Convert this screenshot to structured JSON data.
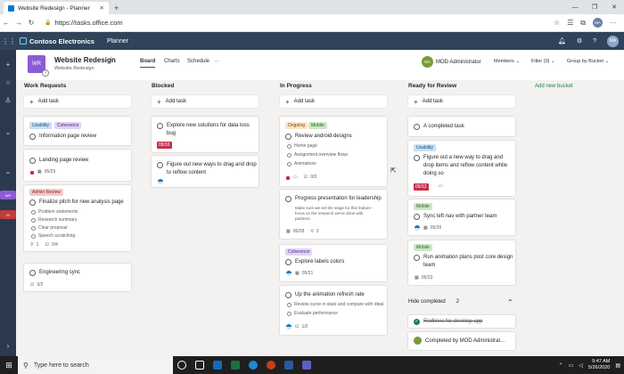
{
  "browser": {
    "tab_title": "Website Redesign - Planner",
    "tab_close": "✕",
    "new_tab": "+",
    "win_min": "—",
    "win_max": "❐",
    "win_close": "✕",
    "url": "https://tasks.office.com",
    "back": "←",
    "forward": "→",
    "refresh": "↻",
    "profile_initials": "MA"
  },
  "app": {
    "brand": "Contoso Electronics",
    "app_name": "Planner",
    "user_initials": "MA"
  },
  "plan": {
    "tile_initials": "WR",
    "info_badge": "i",
    "title": "Website Redesign",
    "star": "☆",
    "subtitle": "Website Redesign",
    "tabs": [
      "Board",
      "Charts",
      "Schedule"
    ],
    "more": "···",
    "owner_initials": "MA",
    "owner_name": "MOD Administrator",
    "members": "Members ⌄",
    "filter": "Filter (0) ⌄",
    "group_by": "Group by Bucket ⌄"
  },
  "rail": {
    "add": "+",
    "tile1": "WR",
    "tile2": "M"
  },
  "board": {
    "add_task": "Add task",
    "add_bucket": "Add new bucket",
    "buckets": [
      "Work Requests",
      "Blocked",
      "In Progress",
      "Ready for Review"
    ],
    "wr_c1": {
      "labels": [
        "Usability",
        "Coherence"
      ],
      "title": "Information page review"
    },
    "wr_c2": {
      "title": "Landing page review",
      "date": "05/29"
    },
    "wr_c3": {
      "label": "Admin Review",
      "title": "Finalize pitch for new analysis page",
      "items": [
        "Problem statements",
        "Research summary",
        "Clear proposal",
        "Speech scratching"
      ],
      "count_a": "1",
      "count_b": "0/4"
    },
    "wr_c4": {
      "title": "Engineering sync",
      "count": "0/2"
    },
    "bl_c1": {
      "title1": "Explore new solutions for data loss",
      "title2": "bug",
      "due": "05/16"
    },
    "bl_c2": {
      "title1": "Figure out new ways to drag and drop",
      "title2": "to reflow content"
    },
    "ip_c1": {
      "labels": [
        "Ongoing",
        "Mobile"
      ],
      "title": "Review android designs",
      "items": [
        "Home page",
        "Assignment overview flows",
        "Animations"
      ],
      "count": "0/3"
    },
    "ip_c2": {
      "title": "Progress presentation for leadership",
      "desc1": "Make sure we set the stage for this feature -",
      "desc2": "focus on the research we've done with",
      "desc3": "partners.",
      "date": "05/28",
      "count": "2"
    },
    "ip_c3": {
      "label": "Coherence",
      "title": "Explore labels colors",
      "date": "05/21"
    },
    "ip_c4": {
      "title": "Up the animation refresh rate",
      "items": [
        "Review curve in state and compare with ideal",
        "Evaluate performance"
      ],
      "count": "1/2"
    },
    "rr_c1": {
      "title": "A completed task"
    },
    "rr_c2": {
      "label": "Usability",
      "title1": "Figure out a new way to drag and",
      "title2": "drop items and reflow content while",
      "title3": "doing so",
      "due": "05/12"
    },
    "rr_c3": {
      "label": "Mobile",
      "title": "Sync left nav with partner team",
      "date": "05/26"
    },
    "rr_c4": {
      "label": "Mobile",
      "title1": "Run animation plans post core design",
      "title2": "team",
      "date": "05/23"
    },
    "hide_completed": "Hide completed",
    "completed_count": "2",
    "done1": "Redlines for desktop app",
    "done2": "Completed by MOD Administrat..."
  },
  "taskbar": {
    "search_placeholder": "Type here to search",
    "time": "9:47 AM",
    "date": "5/26/2020"
  },
  "colors": {
    "brand_bar": "#31435a",
    "accent": "#464775",
    "overdue": "#c4314b"
  }
}
